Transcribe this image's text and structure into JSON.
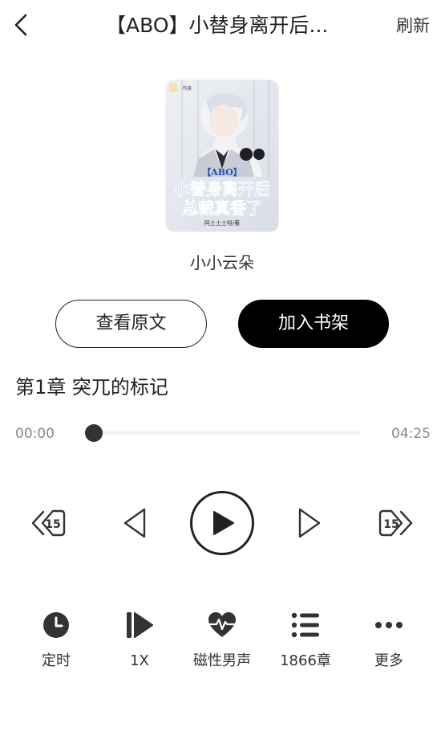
{
  "header": {
    "title": "【ABO】小替身离开后...",
    "refresh_label": "刷新"
  },
  "book": {
    "cover_text_tag": "【ABO】",
    "cover_text_line1": "小替身离开后",
    "cover_text_line2": "总裁真香了",
    "cover_text_author": "阿土土土呀/著",
    "author": "小小云朵"
  },
  "actions": {
    "view_original": "查看原文",
    "add_to_shelf": "加入书架"
  },
  "chapter_title": "第1章  突兀的标记",
  "player": {
    "current_time": "00:00",
    "total_time": "04:25",
    "progress": 0,
    "rewind_seconds": "15",
    "forward_seconds": "15"
  },
  "toolbar": {
    "timer": "定时",
    "speed": "1X",
    "voice": "磁性男声",
    "chapters": "1866章",
    "more": "更多"
  },
  "colors": {
    "accent": "#000000",
    "icon": "#333333",
    "secondary_text": "#888888"
  }
}
